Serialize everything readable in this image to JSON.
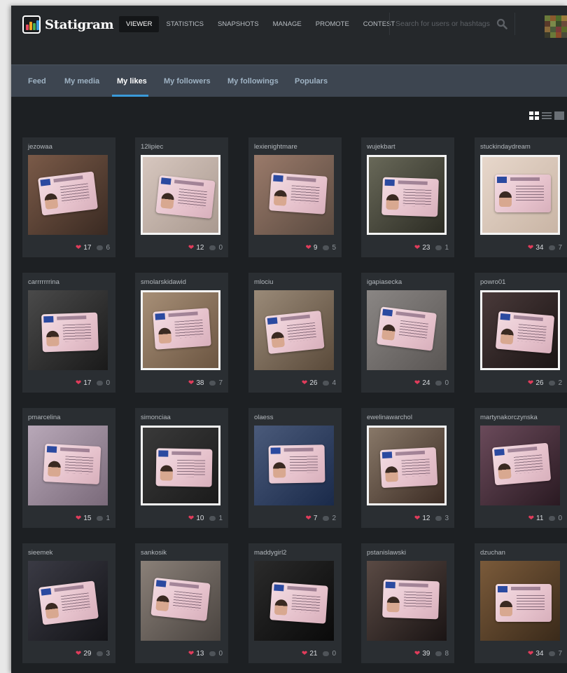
{
  "app": {
    "name": "Statigram",
    "logo_bar_colors": [
      "#e84a5f",
      "#f5a623",
      "#4caf50",
      "#3a9ad9"
    ]
  },
  "nav": {
    "items": [
      {
        "label": "VIEWER",
        "active": true
      },
      {
        "label": "STATISTICS",
        "active": false
      },
      {
        "label": "SNAPSHOTS",
        "active": false
      },
      {
        "label": "MANAGE",
        "active": false
      },
      {
        "label": "PROMOTE",
        "active": false
      },
      {
        "label": "CONTEST",
        "active": false
      }
    ]
  },
  "search": {
    "placeholder": "Search for users or hashtags",
    "icon": "magnifier-icon"
  },
  "subnav": {
    "items": [
      {
        "label": "Feed",
        "active": false
      },
      {
        "label": "My media",
        "active": false
      },
      {
        "label": "My likes",
        "active": true
      },
      {
        "label": "My followers",
        "active": false
      },
      {
        "label": "My followings",
        "active": false
      },
      {
        "label": "Populars",
        "active": false
      }
    ]
  },
  "view_toggle": [
    "grid-view-icon",
    "list-view-icon",
    "single-view-icon"
  ],
  "colors": {
    "accent": "#3a9ad9",
    "heart": "#e13c5b",
    "background": "#1d2023",
    "card": "#2a2e32"
  },
  "photos": [
    {
      "user": "jezowaa",
      "likes": "17",
      "comments": "6"
    },
    {
      "user": "12lipiec",
      "likes": "12",
      "comments": "0"
    },
    {
      "user": "lexienightmare",
      "likes": "9",
      "comments": "5"
    },
    {
      "user": "wujekbart",
      "likes": "23",
      "comments": "1"
    },
    {
      "user": "stuckindaydream",
      "likes": "34",
      "comments": "7"
    },
    {
      "user": "carrrrrrrina",
      "likes": "17",
      "comments": "0"
    },
    {
      "user": "smolarskidawid",
      "likes": "38",
      "comments": "7"
    },
    {
      "user": "mlociu",
      "likes": "26",
      "comments": "4"
    },
    {
      "user": "igapiasecka",
      "likes": "24",
      "comments": "0"
    },
    {
      "user": "powro01",
      "likes": "26",
      "comments": "2"
    },
    {
      "user": "pmarcelina",
      "likes": "15",
      "comments": "1"
    },
    {
      "user": "simonciaa",
      "likes": "10",
      "comments": "1"
    },
    {
      "user": "olaess",
      "likes": "7",
      "comments": "2"
    },
    {
      "user": "ewelinawarchol",
      "likes": "12",
      "comments": "3"
    },
    {
      "user": "martynakorczynska",
      "likes": "11",
      "comments": "0"
    },
    {
      "user": "sieemek",
      "likes": "29",
      "comments": "3"
    },
    {
      "user": "sankosik",
      "likes": "13",
      "comments": "0"
    },
    {
      "user": "maddygirl2",
      "likes": "21",
      "comments": "0"
    },
    {
      "user": "pstanislawski",
      "likes": "39",
      "comments": "8"
    },
    {
      "user": "dzuchan",
      "likes": "34",
      "comments": "7"
    }
  ]
}
